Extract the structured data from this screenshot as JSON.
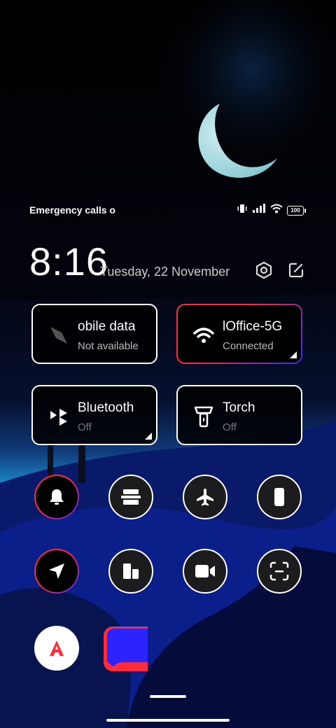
{
  "status_bar": {
    "carrier_text": "Emergency calls o",
    "battery": "100",
    "icons": [
      "vibrate-icon",
      "signal-icon",
      "wifi-icon",
      "battery-icon"
    ]
  },
  "header": {
    "time": "8:16",
    "date": "Tuesday, 22 November",
    "settings_icon": "settings-hexagon-icon",
    "edit_icon": "edit-icon"
  },
  "tiles": [
    {
      "id": "mobile-data",
      "label": "obile data",
      "sub": "Not available",
      "icon": "mobile-data-icon",
      "active": false
    },
    {
      "id": "wifi",
      "label": "lOffice-5G",
      "sub": "Connected",
      "icon": "wifi-icon",
      "active": true
    },
    {
      "id": "bluetooth",
      "label": "Bluetooth",
      "sub": "Off",
      "icon": "bluetooth-icon",
      "active": false
    },
    {
      "id": "torch",
      "label": "Torch",
      "sub": "Off",
      "icon": "torch-icon",
      "active": false
    }
  ],
  "toggles": [
    {
      "id": "ringer",
      "icon": "bell-icon",
      "active": true
    },
    {
      "id": "screen-mirror",
      "icon": "screencast-icon",
      "active": false
    },
    {
      "id": "airplane",
      "icon": "airplane-icon",
      "active": false
    },
    {
      "id": "auto-rotate",
      "icon": "phone-rotate-icon",
      "active": false
    },
    {
      "id": "location",
      "icon": "location-arrow-icon",
      "active": true
    },
    {
      "id": "lock-screen",
      "icon": "lock-screen-icon",
      "active": false
    },
    {
      "id": "screen-recorder",
      "icon": "video-camera-icon",
      "active": false
    },
    {
      "id": "scanner",
      "icon": "scan-icon",
      "active": false
    },
    {
      "id": "auto-brightness",
      "icon": "auto-brightness-icon",
      "active": false
    }
  ],
  "colors": {
    "accent_red": "#ff2b3b",
    "accent_blue": "#2b24ff"
  }
}
